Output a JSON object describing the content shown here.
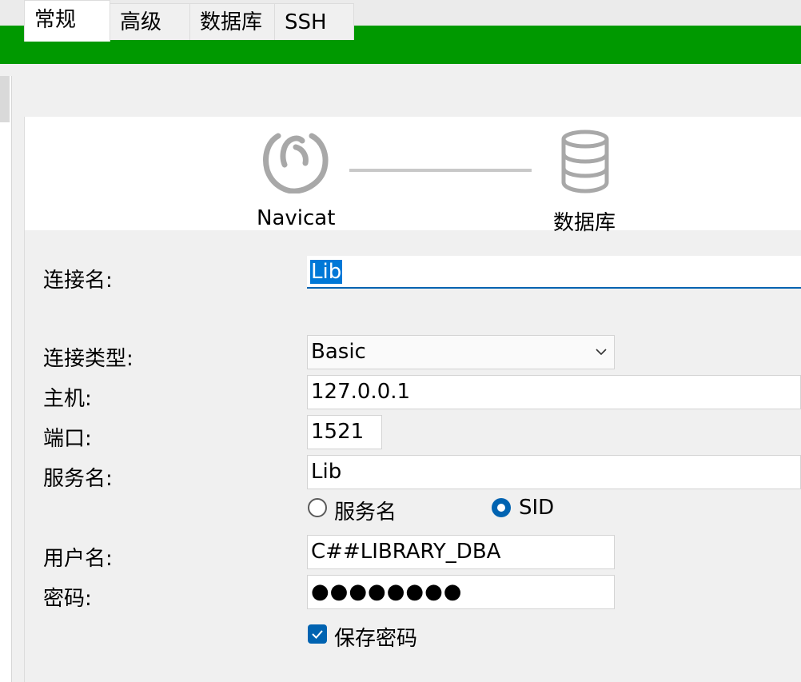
{
  "colors": {
    "header_green": "#009900",
    "accent": "#0063b1",
    "selection": "#0078d7"
  },
  "tabs": [
    {
      "label": "常规",
      "active": true
    },
    {
      "label": "高级",
      "active": false
    },
    {
      "label": "数据库",
      "active": false
    },
    {
      "label": "SSH",
      "active": false
    }
  ],
  "banner": {
    "left_label": "Navicat",
    "left_icon": "navicat-logo-icon",
    "right_label": "数据库",
    "right_icon": "database-icon"
  },
  "form": {
    "connection_name": {
      "label": "连接名:",
      "value": "Lib"
    },
    "connection_type": {
      "label": "连接类型:",
      "value": "Basic"
    },
    "host": {
      "label": "主机:",
      "value": "127.0.0.1"
    },
    "port": {
      "label": "端口:",
      "value": "1521"
    },
    "service_name": {
      "label": "服务名:",
      "value": "Lib",
      "options": [
        {
          "label": "服务名",
          "selected": false
        },
        {
          "label": "SID",
          "selected": true
        }
      ]
    },
    "username": {
      "label": "用户名:",
      "value": "C##LIBRARY_DBA"
    },
    "password": {
      "label": "密码:",
      "value": "●●●●●●●●"
    },
    "save_password": {
      "label": "保存密码",
      "checked": true
    }
  }
}
